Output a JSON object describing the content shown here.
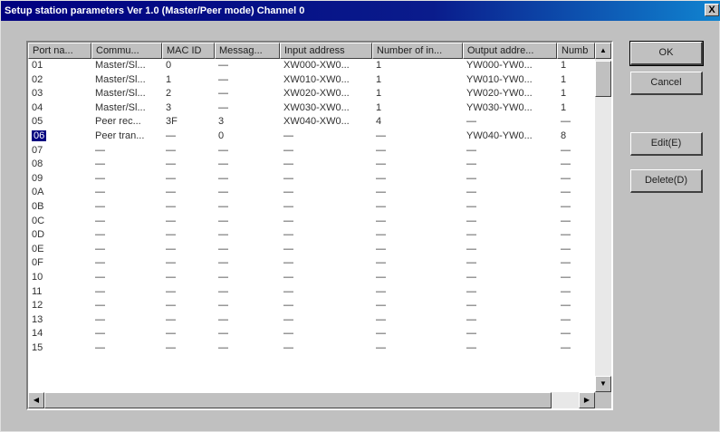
{
  "window": {
    "title": "Setup station parameters Ver 1.0 (Master/Peer mode) Channel 0",
    "close_label": "X"
  },
  "table": {
    "columns": [
      "Port na...",
      "Commu...",
      "MAC ID",
      "Messag...",
      "Input address",
      "Number of in...",
      "Output addre...",
      "Numb"
    ],
    "rows": [
      [
        "01",
        "Master/Sl...",
        "0",
        "—",
        "XW000-XW0...",
        "1",
        "YW000-YW0...",
        "1"
      ],
      [
        "02",
        "Master/Sl...",
        "1",
        "—",
        "XW010-XW0...",
        "1",
        "YW010-YW0...",
        "1"
      ],
      [
        "03",
        "Master/Sl...",
        "2",
        "—",
        "XW020-XW0...",
        "1",
        "YW020-YW0...",
        "1"
      ],
      [
        "04",
        "Master/Sl...",
        "3",
        "—",
        "XW030-XW0...",
        "1",
        "YW030-YW0...",
        "1"
      ],
      [
        "05",
        "Peer rec...",
        "3F",
        "3",
        "XW040-XW0...",
        "4",
        "—",
        "—"
      ],
      [
        "06",
        "Peer tran...",
        "—",
        "0",
        "—",
        "—",
        "YW040-YW0...",
        "8"
      ],
      [
        "07",
        "—",
        "—",
        "—",
        "—",
        "—",
        "—",
        "—"
      ],
      [
        "08",
        "—",
        "—",
        "—",
        "—",
        "—",
        "—",
        "—"
      ],
      [
        "09",
        "—",
        "—",
        "—",
        "—",
        "—",
        "—",
        "—"
      ],
      [
        "0A",
        "—",
        "—",
        "—",
        "—",
        "—",
        "—",
        "—"
      ],
      [
        "0B",
        "—",
        "—",
        "—",
        "—",
        "—",
        "—",
        "—"
      ],
      [
        "0C",
        "—",
        "—",
        "—",
        "—",
        "—",
        "—",
        "—"
      ],
      [
        "0D",
        "—",
        "—",
        "—",
        "—",
        "—",
        "—",
        "—"
      ],
      [
        "0E",
        "—",
        "—",
        "—",
        "—",
        "—",
        "—",
        "—"
      ],
      [
        "0F",
        "—",
        "—",
        "—",
        "—",
        "—",
        "—",
        "—"
      ],
      [
        "10",
        "—",
        "—",
        "—",
        "—",
        "—",
        "—",
        "—"
      ],
      [
        "11",
        "—",
        "—",
        "—",
        "—",
        "—",
        "—",
        "—"
      ],
      [
        "12",
        "—",
        "—",
        "—",
        "—",
        "—",
        "—",
        "—"
      ],
      [
        "13",
        "—",
        "—",
        "—",
        "—",
        "—",
        "—",
        "—"
      ],
      [
        "14",
        "—",
        "—",
        "—",
        "—",
        "—",
        "—",
        "—"
      ],
      [
        "15",
        "—",
        "—",
        "—",
        "—",
        "—",
        "—",
        "—"
      ]
    ],
    "selected_row": "06"
  },
  "buttons": {
    "ok": "OK",
    "cancel": "Cancel",
    "edit": "Edit(E)",
    "delete": "Delete(D)"
  },
  "icons": {
    "scroll_up": "up-arrow-icon",
    "scroll_down": "down-arrow-icon",
    "scroll_left": "left-arrow-icon",
    "scroll_right": "right-arrow-icon"
  }
}
